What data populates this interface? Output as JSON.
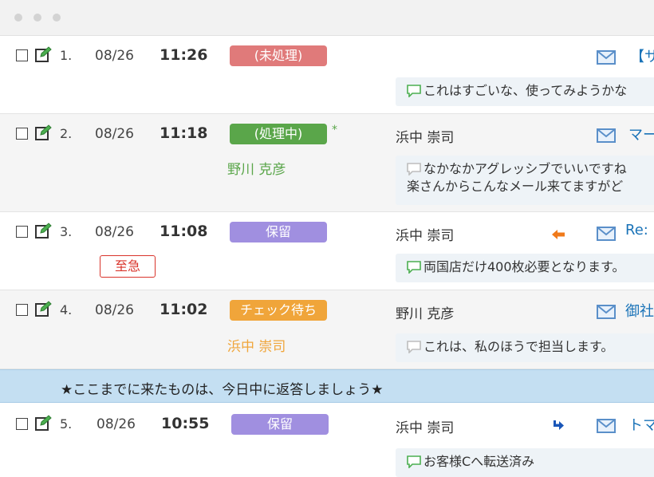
{
  "rows": [
    {
      "number": "1.",
      "date": "08/26",
      "time": "11:26",
      "status": {
        "label": "(未処理)",
        "color": "#e07a7a"
      },
      "assignee": "",
      "user": "",
      "subject": "【サ",
      "preview_lines": [
        "これはすごいな、使ってみようかな"
      ],
      "preview_icon_color": "#4caf50"
    },
    {
      "number": "2.",
      "date": "08/26",
      "time": "11:18",
      "status": {
        "label": "(処理中)",
        "color": "#5aa64a"
      },
      "star": "*",
      "assignee": "野川 克彦",
      "assignee_color": "#5aa64a",
      "user": "浜中 崇司",
      "subject": "マー",
      "preview_lines": [
        "なかなかアグレッシブでいいですね",
        "楽さんからこんなメール来てますがど"
      ],
      "preview_icon_color": "#bdbdbd"
    },
    {
      "number": "3.",
      "date": "08/26",
      "time": "11:08",
      "status": {
        "label": "保留",
        "color": "#a08fe0"
      },
      "urgent": "至急",
      "user": "浜中 崇司",
      "subject": "Re:",
      "preview_lines": [
        "両国店だけ400枚必要となります。"
      ],
      "preview_icon_color": "#4caf50"
    },
    {
      "number": "4.",
      "date": "08/26",
      "time": "11:02",
      "status": {
        "label": "チェック待ち",
        "color": "#f0a53a"
      },
      "assignee": "浜中 崇司",
      "assignee_color": "#f0a53a",
      "user": "野川 克彦",
      "subject": "御社",
      "preview_lines": [
        "これは、私のほうで担当します。"
      ],
      "preview_icon_color": "#bdbdbd"
    },
    {
      "number": "5.",
      "date": "08/26",
      "time": "10:55",
      "status": {
        "label": "保留",
        "color": "#a08fe0"
      },
      "user": "浜中 崇司",
      "subject": "トマ",
      "preview_lines": [
        "お客様Cへ転送済み"
      ],
      "preview_icon_color": "#4caf50"
    }
  ],
  "notice": "★ここまでに来たものは、今日中に返答しましょう★",
  "colors": {
    "reply_arrow": "#f07a1a",
    "forward_arrow": "#1a56b8",
    "mail_icon": "#5a8fc9"
  }
}
